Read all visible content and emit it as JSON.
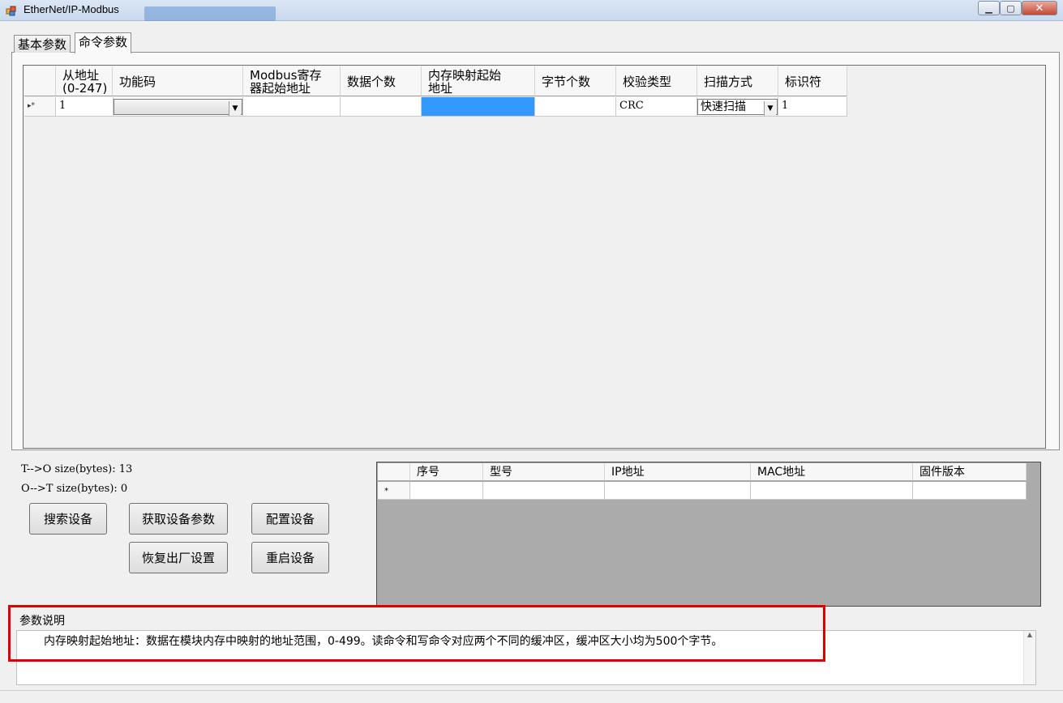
{
  "window": {
    "title": "EtherNet/IP-Modbus",
    "taskbar_ghost": "",
    "minimize_icon": "minimize-icon",
    "maximize_icon": "maximize-icon",
    "close_icon": "close-icon",
    "close_color": "#c34a36"
  },
  "tabs": [
    {
      "label": "基本参数",
      "selected": false
    },
    {
      "label": "命令参数",
      "selected": true
    }
  ],
  "command_grid": {
    "columns": [
      "从地址\n(0-247)",
      "功能码",
      "Modbus寄存\n器起始地址",
      "数据个数",
      "内存映射起始\n地址",
      "字节个数",
      "校验类型",
      "扫描方式",
      "标识符"
    ],
    "row_marker": "▸*",
    "rows": [
      {
        "slave_addr": "1",
        "function_code": "",
        "modbus_start": "",
        "data_count": "",
        "mem_map_start": "",
        "byte_count": "",
        "checksum": "CRC",
        "scan_mode": "快速扫描",
        "identifier": "1"
      }
    ],
    "selected_cell_color": "#3399ff"
  },
  "stats": {
    "t_to_o": "T-->O size(bytes): 13",
    "o_to_t": "O-->T size(bytes): 0"
  },
  "buttons": {
    "search": "搜索设备",
    "get_params": "获取设备参数",
    "configure": "配置设备",
    "factory_reset": "恢复出厂设置",
    "restart": "重启设备"
  },
  "device_grid": {
    "columns": [
      "序号",
      "型号",
      "IP地址",
      "MAC地址",
      "固件版本"
    ],
    "row_marker": "*",
    "background": "#ababab"
  },
  "description": {
    "label": "参数说明",
    "text": "内存映射起始地址：数据在模块内存中映射的地址范围，0-499。读命令和写命令对应两个不同的缓冲区，缓冲区大小均为500个字节。",
    "highlight_color": "#e00000"
  }
}
